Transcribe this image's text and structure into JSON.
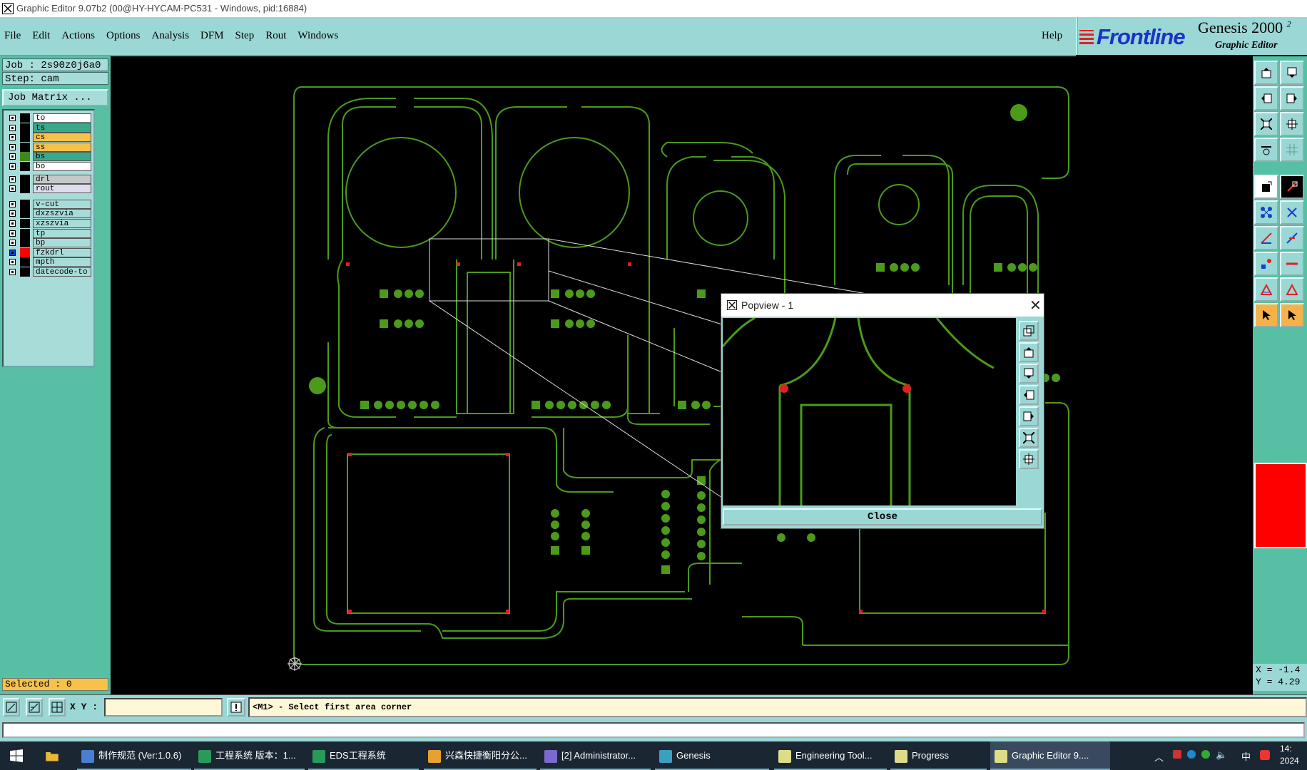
{
  "window": {
    "title": "Graphic Editor 9.07b2 (00@HY-HYCAM-PC531 - Windows, pid:16884)"
  },
  "menu": {
    "items": [
      "File",
      "Edit",
      "Actions",
      "Options",
      "Analysis",
      "DFM",
      "Step",
      "Rout",
      "Windows"
    ],
    "help": "Help"
  },
  "brand": {
    "logo": "Frontline",
    "product": "Genesis 2000",
    "product_sup": "2",
    "subtitle": "Graphic Editor"
  },
  "job": {
    "job_label": "Job : 2s90z0j6a0",
    "step_label": "Step: cam",
    "matrix_button": "Job Matrix ..."
  },
  "layers": [
    {
      "name": "to",
      "bg": "#ffffff",
      "swatch": "#000000",
      "checked": true
    },
    {
      "name": "ts",
      "bg": "#3aa98a",
      "swatch": "#000000",
      "checked": true
    },
    {
      "name": "cs",
      "bg": "#f6c24a",
      "swatch": "#000000",
      "checked": true
    },
    {
      "name": "ss",
      "bg": "#f6c24a",
      "swatch": "#000000",
      "checked": true
    },
    {
      "name": "bs",
      "bg": "#3aa98a",
      "swatch": "#3d8a1a",
      "checked": true
    },
    {
      "name": "bo",
      "bg": "#ffffff",
      "swatch": "#000000",
      "checked": true
    },
    {
      "name": "drl",
      "bg": "#c4c8c8",
      "swatch": "#000000",
      "checked": true
    },
    {
      "name": "rout",
      "bg": "#dde",
      "swatch": "#000000",
      "checked": true
    },
    {
      "name": "v-cut",
      "bg": "#a8dcd8",
      "swatch": "#000000",
      "checked": true
    },
    {
      "name": "dxzszvia",
      "bg": "#a8dcd8",
      "swatch": "#000000",
      "checked": true
    },
    {
      "name": "xzszvia",
      "bg": "#a8dcd8",
      "swatch": "#000000",
      "checked": true
    },
    {
      "name": "tp",
      "bg": "#a8dcd8",
      "swatch": "#000000",
      "checked": true
    },
    {
      "name": "bp",
      "bg": "#a8dcd8",
      "swatch": "#000000",
      "checked": true
    },
    {
      "name": "fzkdrl",
      "bg": "#a8dcd8",
      "swatch": "#ff0000",
      "checked": true,
      "active": true
    },
    {
      "name": "mpth",
      "bg": "#a8dcd8",
      "swatch": "#000000",
      "checked": true
    },
    {
      "name": "datecode-to",
      "bg": "#a8dcd8",
      "swatch": "#000000",
      "checked": true
    }
  ],
  "selection": {
    "label": "Selected : 0"
  },
  "coords": {
    "x": "X = -1.4",
    "y": "Y = 4.29"
  },
  "popview": {
    "title": "Popview - 1",
    "close": "Close"
  },
  "status": {
    "xy_label": "X Y :",
    "xy_value": "",
    "message": "<M1> - Select first area corner"
  },
  "taskbar": {
    "items": [
      {
        "label": "制作规范 (Ver:1.0.6)",
        "icon_color": "#4a7fd0"
      },
      {
        "label": "工程系统  版本：1...",
        "icon_color": "#2a9a5a"
      },
      {
        "label": "EDS工程系统",
        "icon_color": "#2a9a5a"
      },
      {
        "label": "兴森快捷衡阳分公...",
        "icon_color": "#e8a030"
      },
      {
        "label": "[2] Administrator...",
        "icon_color": "#7a6ad0"
      },
      {
        "label": "Genesis",
        "icon_color": "#3aa0c0"
      },
      {
        "label": "Engineering Tool...",
        "icon_color": "#dddd88"
      },
      {
        "label": "Progress",
        "icon_color": "#dddd88"
      },
      {
        "label": "Graphic Editor 9....",
        "icon_color": "#dddd88",
        "active": true
      }
    ],
    "tray": {
      "ime": "中",
      "time": "14:",
      "date": "2024"
    }
  },
  "colors": {
    "panel": "#57bfa4",
    "menu_bg": "#9ad7d5",
    "copper": "#4c9a1a",
    "drill": "#e02020"
  }
}
